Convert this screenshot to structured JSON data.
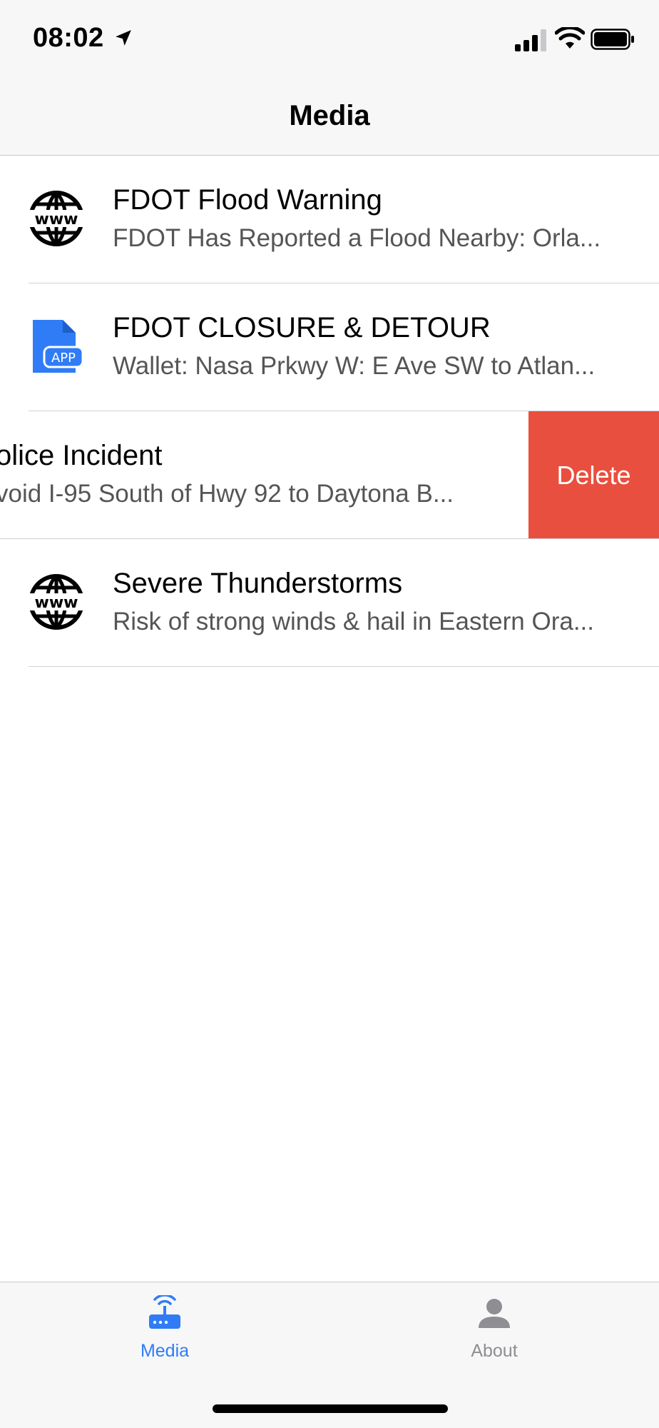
{
  "status_bar": {
    "time": "08:02",
    "icons": [
      "location-arrow-icon",
      "cellular-signal-icon",
      "wifi-icon",
      "battery-icon"
    ]
  },
  "nav": {
    "title": "Media"
  },
  "list": {
    "items": [
      {
        "icon": "www-globe-icon",
        "title": "FDOT Flood Warning",
        "subtitle": "FDOT Has Reported a Flood Nearby: Orla..."
      },
      {
        "icon": "app-file-icon",
        "title": "FDOT CLOSURE & DETOUR",
        "subtitle": "Wallet: Nasa Prkwy W: E Ave SW to Atlan..."
      },
      {
        "icon": null,
        "title": "olice Incident",
        "subtitle": "void I-95 South of Hwy 92 to Daytona B...",
        "swiped": true,
        "action_label": "Delete"
      },
      {
        "icon": "www-globe-icon",
        "title": "Severe Thunderstorms",
        "subtitle": "Risk of strong winds & hail in Eastern Ora..."
      }
    ]
  },
  "tab_bar": {
    "tabs": [
      {
        "label": "Media",
        "icon": "router-wifi-icon",
        "selected": true
      },
      {
        "label": "About",
        "icon": "person-icon",
        "selected": false
      }
    ]
  },
  "colors": {
    "accent": "#2f7cf6",
    "delete": "#e94f3e",
    "inactive": "#8e8e93"
  }
}
